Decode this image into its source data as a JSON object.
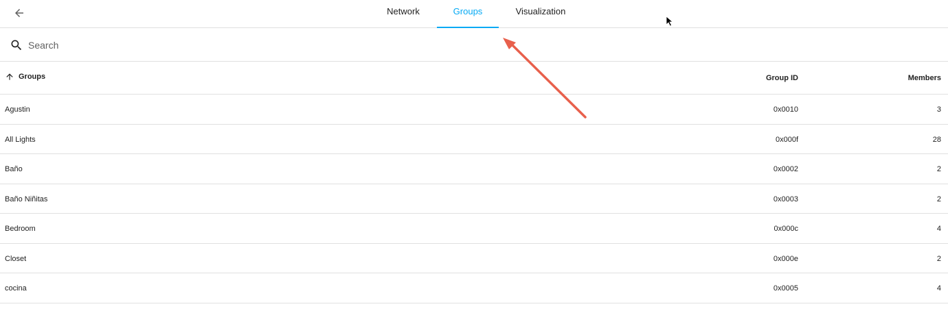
{
  "toolbar": {
    "back_icon": "arrow-left-icon"
  },
  "tabs": [
    {
      "label": "Network",
      "active": false
    },
    {
      "label": "Groups",
      "active": true
    },
    {
      "label": "Visualization",
      "active": false
    }
  ],
  "search": {
    "placeholder": "Search",
    "value": "",
    "icon": "search-icon"
  },
  "table": {
    "columns": {
      "name": "Groups",
      "group_id": "Group ID",
      "members": "Members"
    },
    "sort_icon": "arrow-up-icon",
    "rows": [
      {
        "name": "Agustin",
        "group_id": "0x0010",
        "members": "3"
      },
      {
        "name": "All Lights",
        "group_id": "0x000f",
        "members": "28"
      },
      {
        "name": "Baño",
        "group_id": "0x0002",
        "members": "2"
      },
      {
        "name": "Baño Niñitas",
        "group_id": "0x0003",
        "members": "2"
      },
      {
        "name": "Bedroom",
        "group_id": "0x000c",
        "members": "4"
      },
      {
        "name": "Closet",
        "group_id": "0x000e",
        "members": "2"
      },
      {
        "name": "cocina",
        "group_id": "0x0005",
        "members": "4"
      }
    ]
  },
  "colors": {
    "accent": "#03a9f4",
    "annotation_arrow": "#e8604c",
    "divider": "#e0e0e0",
    "text": "#212121"
  }
}
